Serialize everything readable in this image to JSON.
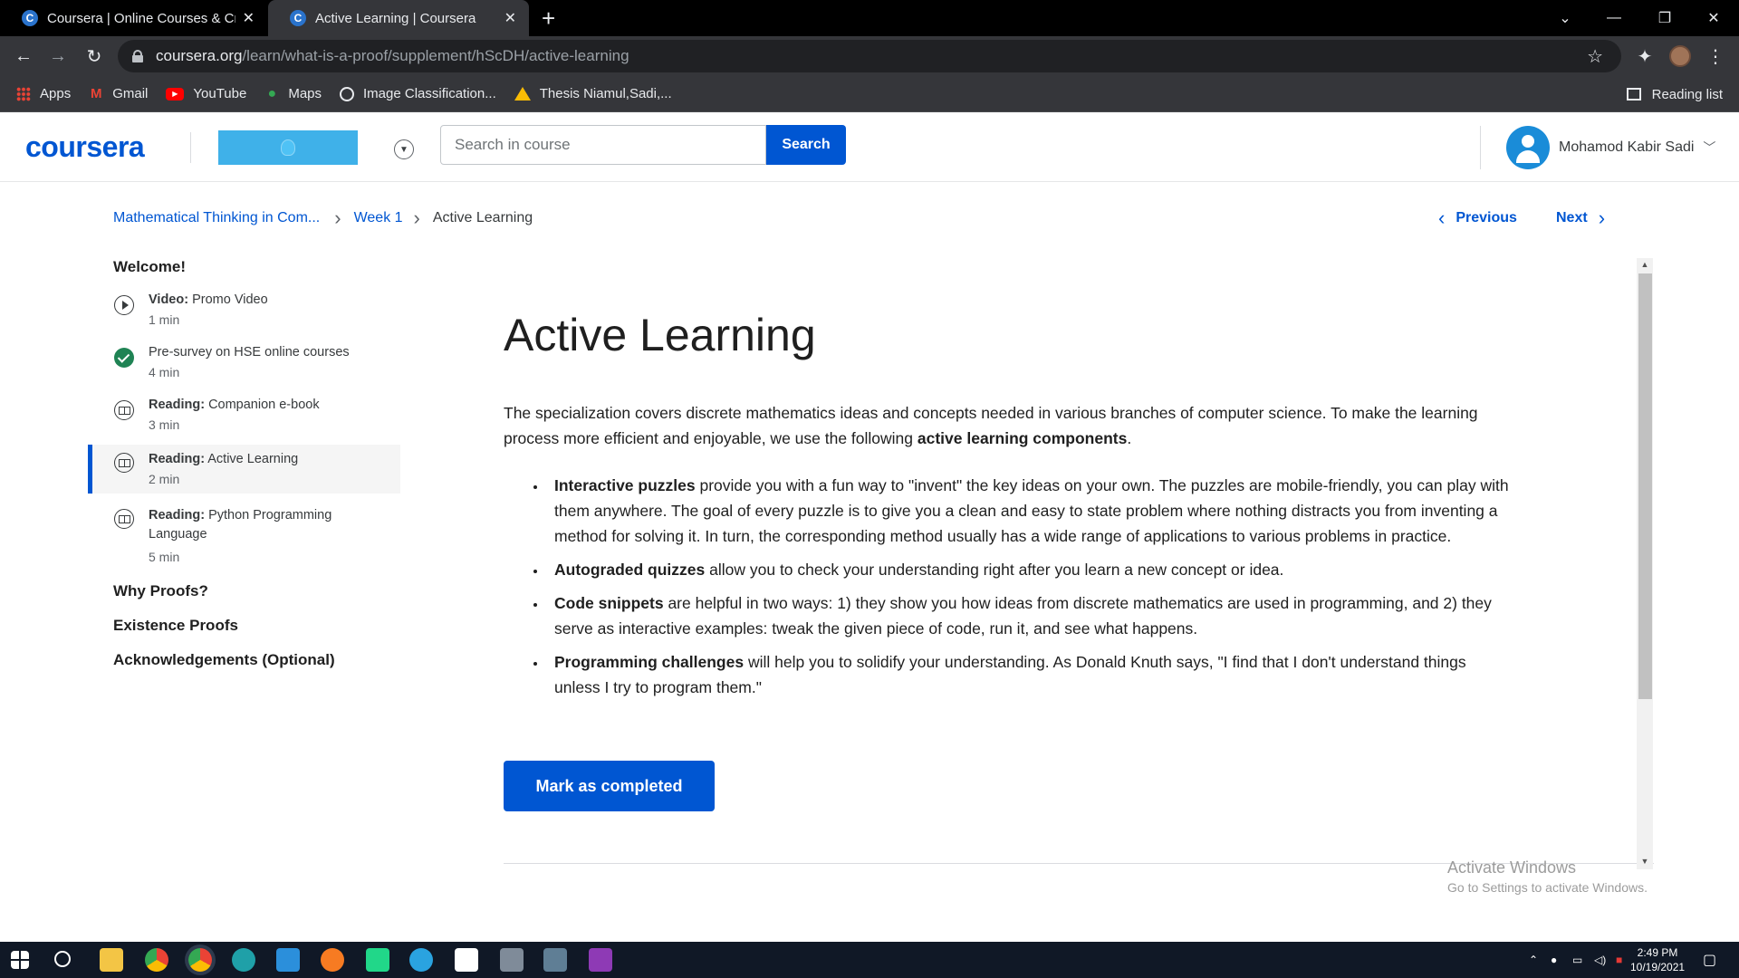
{
  "browser": {
    "tabs": [
      {
        "label": "Coursera | Online Courses & Crec",
        "active": false
      },
      {
        "label": "Active Learning | Coursera",
        "active": true
      }
    ],
    "url_host": "coursera.org",
    "url_path": "/learn/what-is-a-proof/supplement/hScDH/active-learning",
    "bookmarks": [
      {
        "label": "Apps",
        "icon": "apps-icon"
      },
      {
        "label": "Gmail",
        "icon": "gmail-icon"
      },
      {
        "label": "YouTube",
        "icon": "youtube-icon"
      },
      {
        "label": "Maps",
        "icon": "maps-icon"
      },
      {
        "label": "Image Classification...",
        "icon": "globe-icon"
      },
      {
        "label": "Thesis Niamul,Sadi,...",
        "icon": "drive-icon"
      }
    ],
    "reading_list": "Reading list"
  },
  "header": {
    "logo": "coursera",
    "search_placeholder": "Search in course",
    "search_button": "Search",
    "user_name": "Mohamod Kabir Sadi"
  },
  "breadcrumb": {
    "course": "Mathematical Thinking in Com...",
    "week": "Week 1",
    "current": "Active Learning"
  },
  "nav": {
    "previous": "Previous",
    "next": "Next"
  },
  "sidebar": {
    "sections": [
      {
        "title": "Welcome!"
      },
      {
        "title": "Why Proofs?"
      },
      {
        "title": "Existence Proofs"
      },
      {
        "title": "Acknowledgements (Optional)"
      }
    ],
    "items": [
      {
        "kind": "Video:",
        "title": "Promo Video",
        "duration": "1 min",
        "icon": "play-icon"
      },
      {
        "kind": "",
        "title": "Pre-survey on HSE online courses",
        "duration": "4 min",
        "icon": "check-icon"
      },
      {
        "kind": "Reading:",
        "title": "Companion e-book",
        "duration": "3 min",
        "icon": "book-icon"
      },
      {
        "kind": "Reading:",
        "title": "Active Learning",
        "duration": "2 min",
        "icon": "book-icon"
      },
      {
        "kind": "Reading:",
        "title": "Python Programming Language",
        "duration": "5 min",
        "icon": "book-icon"
      }
    ]
  },
  "content": {
    "title": "Active Learning",
    "intro_text": "The specialization covers discrete mathematics ideas and concepts needed in various branches of computer science. To make the learning process more efficient and enjoyable, we use the following ",
    "intro_bold": "active learning components",
    "intro_end": ".",
    "bullets": [
      {
        "bold": "Interactive puzzles",
        "text": " provide you with a fun way to \"invent\" the key ideas on your own. The puzzles are mobile-friendly, you can play with them anywhere. The goal of every puzzle is to give you a clean and easy to state problem where nothing distracts you from inventing a method for solving it. In turn, the corresponding method usually has a wide range of applications to various problems in practice."
      },
      {
        "bold": "Autograded quizzes",
        "text": " allow you to check your understanding right after you learn a new concept or idea."
      },
      {
        "bold": "Code snippets",
        "text": " are helpful in two ways: 1) they show you how ideas from discrete mathematics are used in programming, and 2) they serve as interactive examples: tweak the given piece of code, run it, and see what happens."
      },
      {
        "bold": "Programming challenges",
        "text": " will help you to solidify your understanding. As Donald Knuth says, \"I find that I don't understand things unless I try to program them.\""
      }
    ],
    "mark_completed": "Mark as completed"
  },
  "watermark": {
    "line1": "Activate Windows",
    "line2": "Go to Settings to activate Windows."
  },
  "taskbar": {
    "time": "2:49 PM",
    "date": "10/19/2021"
  },
  "colors": {
    "brand": "#0056d2",
    "completed": "#1f8354"
  }
}
